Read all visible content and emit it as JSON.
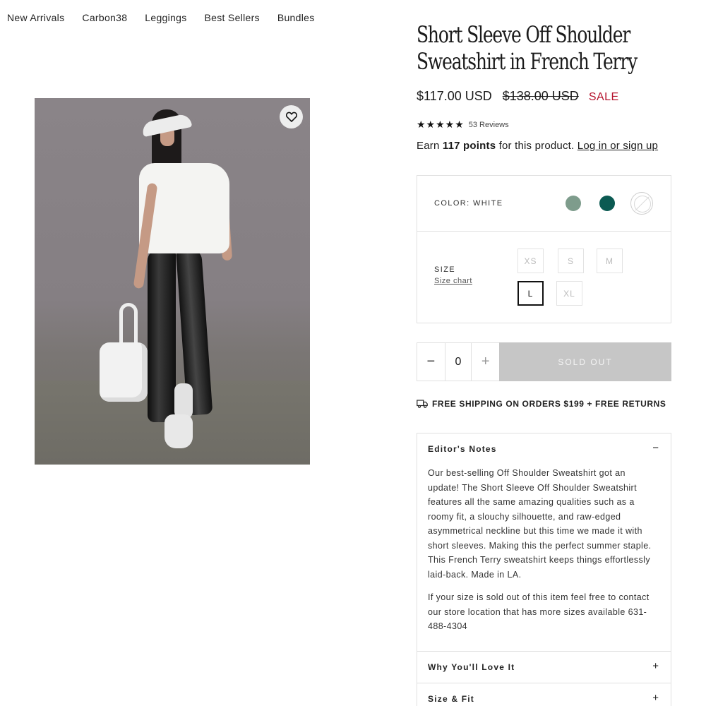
{
  "nav": {
    "items": [
      "New Arrivals",
      "Carbon38",
      "Leggings",
      "Best Sellers",
      "Bundles"
    ]
  },
  "product": {
    "title_line1": "Short Sleeve Off Shoulder",
    "title_line2": "Sweatshirt in French Terry",
    "price": "$117.00 USD",
    "compare_price": "$138.00 USD",
    "sale_label": "SALE",
    "stars": "★★★★★",
    "reviews": "53 Reviews",
    "points_prefix": "Earn",
    "points_value": "117 points",
    "points_suffix": "for this product.",
    "login_link": "Log in or sign up"
  },
  "color": {
    "label": "COLOR: WHITE",
    "swatches": [
      {
        "name": "sage",
        "hex": "#7e9c8c"
      },
      {
        "name": "teal",
        "hex": "#0b5a52"
      },
      {
        "name": "white",
        "hex": "#ffffff",
        "selected": true,
        "unavailable": true
      }
    ]
  },
  "size": {
    "label": "SIZE",
    "chart_link": "Size chart",
    "options": [
      "XS",
      "S",
      "M",
      "L",
      "XL"
    ],
    "selected": "L"
  },
  "cart": {
    "minus": "−",
    "quantity": "0",
    "plus": "+",
    "sold_out": "SOLD OUT"
  },
  "shipping": {
    "text": "FREE SHIPPING ON ORDERS $199 + FREE RETURNS"
  },
  "accordion": {
    "editor_title": "Editor's Notes",
    "editor_toggle": "−",
    "editor_p1": "Our best-selling Off Shoulder Sweatshirt got an update! The Short Sleeve Off Shoulder Sweatshirt features all the same amazing qualities such as a roomy fit, a slouchy silhouette, and raw-edged asymmetrical neckline but this time we made it with short sleeves. Making this the perfect summer staple. This French Terry sweatshirt keeps things effortlessly laid-back. Made in LA.",
    "editor_p2": "If your size is sold out of this item feel free to contact our store location that has more sizes available 631-488-4304",
    "love_title": "Why You'll Love It",
    "love_toggle": "+",
    "fit_title": "Size & Fit",
    "fit_toggle": "+"
  }
}
